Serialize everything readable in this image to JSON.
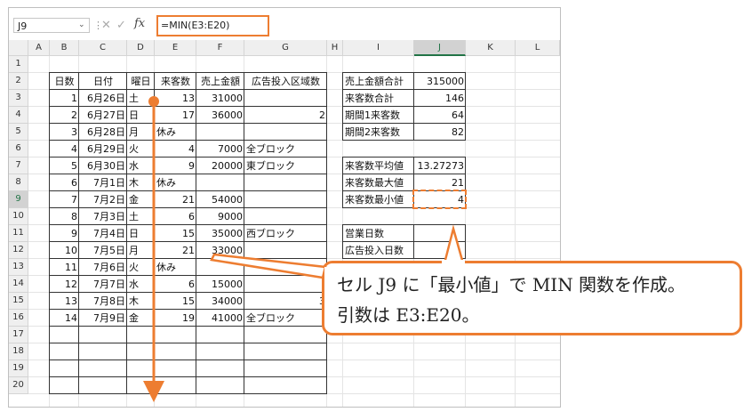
{
  "formula_bar": {
    "name_box": "J9",
    "name_box_arrow": "⌄",
    "dots": "⋮",
    "cancel_icon": "✕",
    "enter_icon": "✓",
    "fx_label": "fx",
    "formula": "=MIN(E3:E20)"
  },
  "columns": [
    "A",
    "B",
    "C",
    "D",
    "E",
    "F",
    "G",
    "H",
    "I",
    "J",
    "K",
    "L"
  ],
  "selected_column": "J",
  "rows": [
    "1",
    "2",
    "3",
    "4",
    "5",
    "6",
    "7",
    "8",
    "9",
    "10",
    "11",
    "12",
    "13",
    "14",
    "15",
    "16",
    "17",
    "18",
    "19",
    "20"
  ],
  "selected_row": "9",
  "main_table": {
    "headers": [
      "日数",
      "日付",
      "曜日",
      "来客数",
      "売上金額",
      "広告投入区域数"
    ],
    "rows": [
      [
        "1",
        "6月26日",
        "土",
        "13",
        "31000",
        ""
      ],
      [
        "2",
        "6月27日",
        "日",
        "17",
        "36000",
        "2"
      ],
      [
        "3",
        "6月28日",
        "月",
        "休み",
        "",
        ""
      ],
      [
        "4",
        "6月29日",
        "火",
        "4",
        "7000",
        "全ブロック"
      ],
      [
        "5",
        "6月30日",
        "水",
        "9",
        "20000",
        "東ブロック"
      ],
      [
        "6",
        "7月1日",
        "木",
        "休み",
        "",
        ""
      ],
      [
        "7",
        "7月2日",
        "金",
        "21",
        "54000",
        ""
      ],
      [
        "8",
        "7月3日",
        "土",
        "6",
        "9000",
        ""
      ],
      [
        "9",
        "7月4日",
        "日",
        "15",
        "35000",
        "西ブロック"
      ],
      [
        "10",
        "7月5日",
        "月",
        "21",
        "33000",
        ""
      ],
      [
        "11",
        "7月6日",
        "火",
        "休み",
        "",
        ""
      ],
      [
        "12",
        "7月7日",
        "水",
        "6",
        "15000",
        ""
      ],
      [
        "13",
        "7月8日",
        "木",
        "15",
        "34000",
        "3"
      ],
      [
        "14",
        "7月9日",
        "金",
        "19",
        "41000",
        "全ブロック"
      ]
    ]
  },
  "summary_table": [
    {
      "label": "売上金額合計",
      "value": "315000"
    },
    {
      "label": "来客数合計",
      "value": "146"
    },
    {
      "label": "期間1来客数",
      "value": "64"
    },
    {
      "label": "期間2来客数",
      "value": "82"
    }
  ],
  "stats_table": [
    {
      "label": "来客数平均値",
      "value": "13.27273"
    },
    {
      "label": "来客数最大値",
      "value": "21"
    },
    {
      "label": "来客数最小値",
      "value": "4"
    }
  ],
  "other_table": [
    {
      "label": "営業日数",
      "value": ""
    },
    {
      "label": "広告投入日数",
      "value": ""
    }
  ],
  "callout": {
    "line1": "セル J9 に「最小値」で MIN 関数を作成。",
    "line2": "引数は E3:E20。"
  },
  "colors": {
    "accent": "#ed7d31",
    "header_selected": "#217346"
  }
}
